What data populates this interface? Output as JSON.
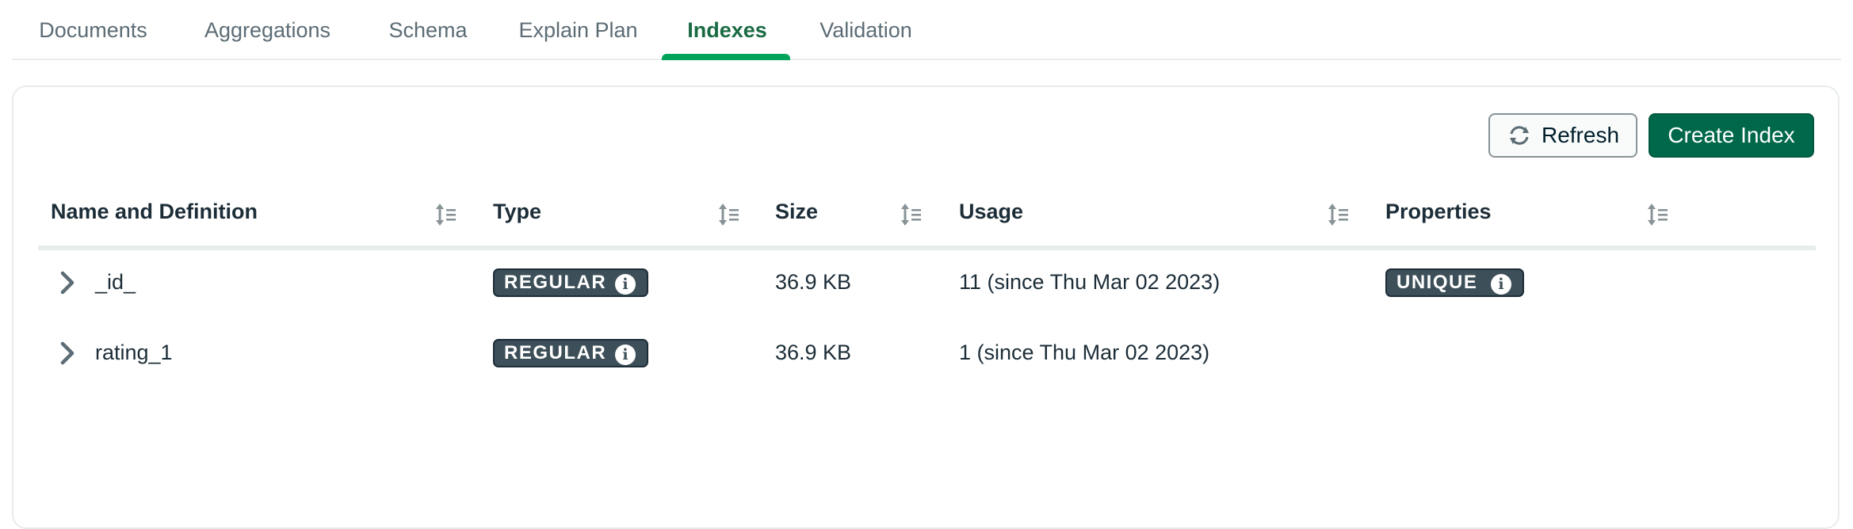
{
  "tabs": [
    {
      "label": "Documents"
    },
    {
      "label": "Aggregations"
    },
    {
      "label": "Schema"
    },
    {
      "label": "Explain Plan"
    },
    {
      "label": "Indexes",
      "active": true
    },
    {
      "label": "Validation"
    }
  ],
  "toolbar": {
    "refresh_label": "Refresh",
    "create_label": "Create Index"
  },
  "table": {
    "columns": [
      "Name and Definition",
      "Type",
      "Size",
      "Usage",
      "Properties"
    ],
    "rows": [
      {
        "name": "_id_",
        "type": "REGULAR",
        "size": "36.9 KB",
        "usage": "11 (since Thu Mar 02 2023)",
        "properties": "UNIQUE"
      },
      {
        "name": "rating_1",
        "type": "REGULAR",
        "size": "36.9 KB",
        "usage": "1 (since Thu Mar 02 2023)",
        "properties": ""
      }
    ]
  },
  "icons": {
    "refresh": "refresh-icon",
    "sort": "sort-icon",
    "expand": "chevron-right-icon",
    "info": "info-icon"
  },
  "colors": {
    "accent": "#00a35c",
    "active_tab_text": "#1a6b44",
    "primary_button": "#00684a",
    "badge": "#3d4f58"
  }
}
